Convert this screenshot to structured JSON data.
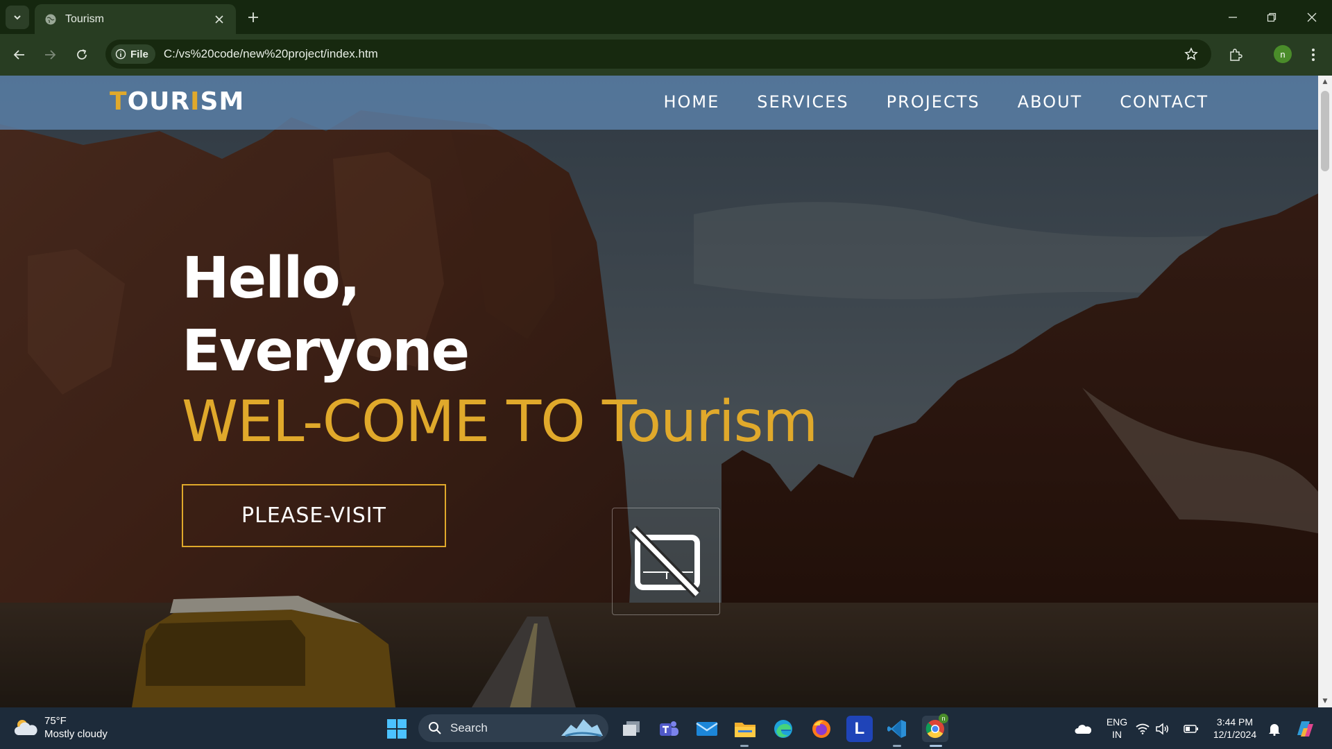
{
  "browser": {
    "tab_title": "Tourism",
    "security_chip": "File",
    "url": "C:/vs%20code/new%20project/index.htm",
    "profile_initial": "n"
  },
  "site": {
    "logo": [
      "T",
      "OUR",
      "I",
      "SM"
    ],
    "nav": [
      "HOME",
      "SERVICES",
      "PROJECTS",
      "ABOUT",
      "CONTACT"
    ],
    "hero": {
      "greeting_line1": "Hello,",
      "greeting_line2": "Everyone",
      "welcome": "WEL-COME TO Tourism",
      "cta": "PLEASE-VISIT"
    },
    "colors": {
      "accent": "#e0a92b",
      "header_bg": "#5d85b0"
    }
  },
  "taskbar": {
    "weather_temp": "75°F",
    "weather_desc": "Mostly cloudy",
    "search_label": "Search",
    "lang_line1": "ENG",
    "lang_line2": "IN",
    "time": "3:44 PM",
    "date": "12/1/2024",
    "app_badge": "n",
    "launcher_letter": "L"
  },
  "icons": [
    "tab-search-icon",
    "globe-icon",
    "close-icon",
    "plus-icon",
    "minimize-icon",
    "restore-icon",
    "back-icon",
    "forward-icon",
    "reload-icon",
    "info-icon",
    "star-icon",
    "extensions-icon",
    "menu-icon",
    "broken-image-icon",
    "windows-start-icon",
    "search-icon",
    "cloud-icon",
    "wifi-icon",
    "volume-icon",
    "battery-icon"
  ]
}
